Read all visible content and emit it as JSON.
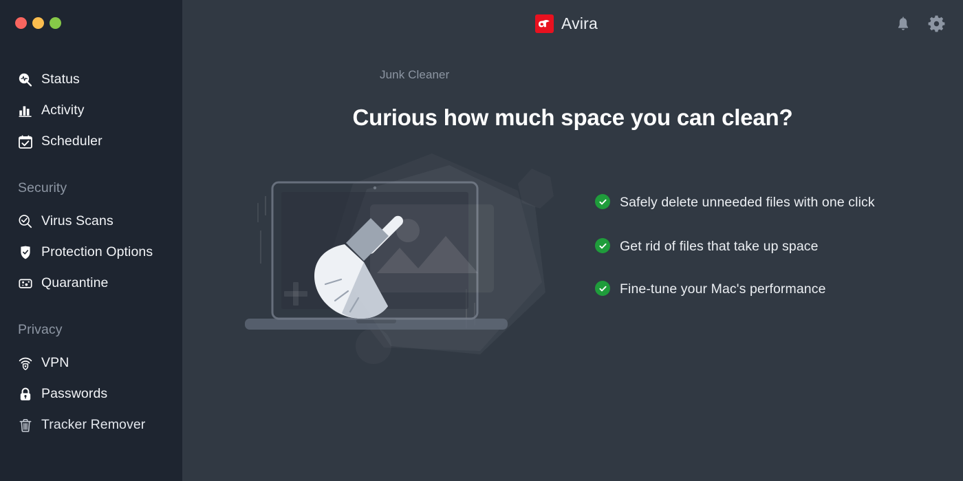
{
  "window": {
    "traffic_lights": [
      {
        "name": "close-button",
        "color": "#f9655f"
      },
      {
        "name": "minimize-button",
        "color": "#fbbd4e"
      },
      {
        "name": "maximize-button",
        "color": "#86c848"
      }
    ]
  },
  "colors": {
    "sidebar_bg": "#1e2530",
    "main_bg": "#313943",
    "brand_red": "#e8111f",
    "check_green": "#1f9c3b",
    "text_primary": "#eceff3",
    "text_muted": "#8d96a3"
  },
  "header": {
    "brand_name": "Avira",
    "brand_icon": "avira-logo-icon",
    "actions": [
      {
        "label": "Notifications",
        "icon": "bell-icon"
      },
      {
        "label": "Settings",
        "icon": "gear-icon"
      }
    ]
  },
  "sidebar": {
    "groups": [
      {
        "title": "",
        "items": [
          {
            "label": "Status",
            "icon": "magnifier-pulse-icon"
          },
          {
            "label": "Activity",
            "icon": "bar-chart-icon"
          },
          {
            "label": "Scheduler",
            "icon": "calendar-check-icon"
          }
        ]
      },
      {
        "title": "Security",
        "items": [
          {
            "label": "Virus Scans",
            "icon": "magnifier-check-icon"
          },
          {
            "label": "Protection Options",
            "icon": "shield-check-icon"
          },
          {
            "label": "Quarantine",
            "icon": "quarantine-dish-icon"
          }
        ]
      },
      {
        "title": "Privacy",
        "items": [
          {
            "label": "VPN",
            "icon": "wifi-shield-icon"
          },
          {
            "label": "Passwords",
            "icon": "lock-icon"
          },
          {
            "label": "Tracker Remover",
            "icon": "trash-icon"
          }
        ]
      }
    ]
  },
  "main": {
    "breadcrumb": "Junk Cleaner",
    "headline": "Curious how much space you can clean?",
    "illustration_name": "junk-cleaner-laptop-broom-illustration",
    "benefits": [
      {
        "text": "Safely delete unneeded files with one click",
        "icon": "check-circle-icon"
      },
      {
        "text": "Get rid of files that take up space",
        "icon": "check-circle-icon"
      },
      {
        "text": "Fine-tune your Mac's performance",
        "icon": "check-circle-icon"
      }
    ]
  }
}
